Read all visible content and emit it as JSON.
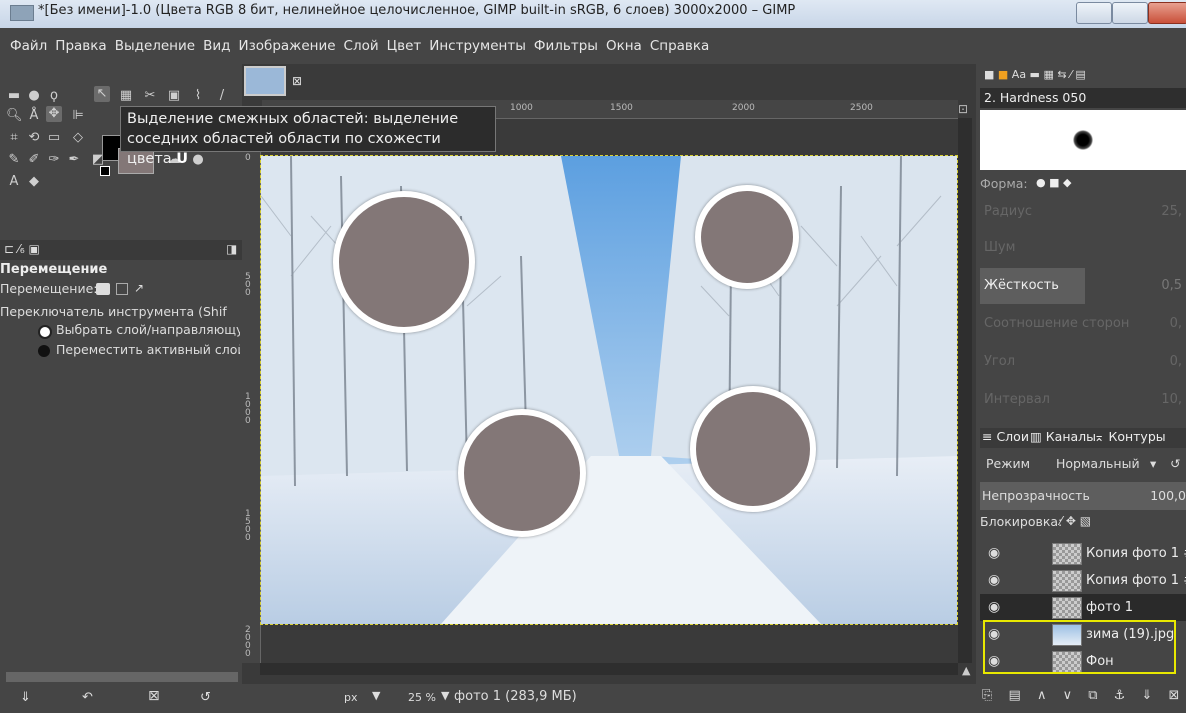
{
  "window": {
    "title": "*[Без имени]-1.0 (Цвета RGB 8 бит, нелинейное целочисленное, GIMP built-in sRGB, 6 слоев) 3000x2000 – GIMP"
  },
  "menu": [
    "Файл",
    "Правка",
    "Выделение",
    "Вид",
    "Изображение",
    "Слой",
    "Цвет",
    "Инструменты",
    "Фильтры",
    "Окна",
    "Справка"
  ],
  "tooltip": {
    "line1": "Выделение смежных областей: выделение",
    "line2": "соседних областей области по схожести цвета",
    "shortcut": "U"
  },
  "tool_options": {
    "title": "Перемещение",
    "move_label": "Перемещение:",
    "switch_label": "Переключатель инструмента  (Shif",
    "radio1": "Выбрать слой/направляющук",
    "radio2": "Переместить активный слой"
  },
  "rulers": {
    "top": [
      "1000",
      "1500",
      "2000",
      "2500"
    ],
    "left": [
      "0",
      "5\n0\n0",
      "1\n0\n0\n0",
      "1\n5\n0\n0",
      "2\n0\n0\n0"
    ]
  },
  "status": {
    "unit": "px",
    "zoom": "25 %",
    "layer_info": "фото 1 (283,9 МБ)"
  },
  "brush": {
    "name": "2. Hardness 050",
    "shape_label": "Форма:",
    "radius_label": "Радиус",
    "radius_value": "25,",
    "noise_label": "Шум",
    "hardness_label": "Жёсткость",
    "hardness_value": "0,5",
    "aspect_label": "Соотношение сторон",
    "aspect_value": "0,",
    "angle_label": "Угол",
    "angle_value": "0,",
    "spacing_label": "Интервал",
    "spacing_value": "10,"
  },
  "layers_panel": {
    "tabs": [
      "Слои",
      "Каналы",
      "Контуры"
    ],
    "mode_label": "Режим",
    "mode_value": "Нормальный",
    "opacity_label": "Непрозрачность",
    "opacity_value": "100,0",
    "lock_label": "Блокировка:",
    "layers": [
      "Копия фото 1 #",
      "Копия фото 1 #",
      "фото 1",
      "зима (19).jpg",
      "Фон"
    ]
  },
  "colors": {
    "circle": "#837777",
    "highlight": "#e8e800"
  }
}
